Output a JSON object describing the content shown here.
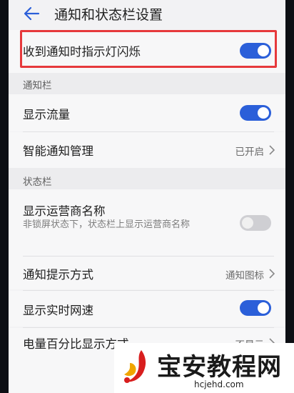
{
  "header": {
    "title": "通知和状态栏设置"
  },
  "top_toggle": {
    "label": "收到通知时指示灯闪烁",
    "on": true
  },
  "notification_bar": {
    "section_label": "通知栏",
    "show_traffic": {
      "label": "显示流量",
      "on": true
    },
    "smart_notify": {
      "label": "智能通知管理",
      "value": "已开启"
    }
  },
  "status_bar": {
    "section_label": "状态栏",
    "carrier_name": {
      "label": "显示运营商名称",
      "sub": "非锁屏状态下，状态栏上显示运营商名称",
      "on": false
    },
    "notify_style": {
      "label": "通知提示方式",
      "value": "通知图标"
    },
    "net_speed": {
      "label": "显示实时网速",
      "on": true
    },
    "battery_percent": {
      "label": "电量百分比显示方式",
      "value": "不显示"
    }
  },
  "watermark": {
    "title": "宝安教程网",
    "url": "hcjehd.com"
  },
  "colors": {
    "accent": "#2b5fd9",
    "highlight": "#e6393c"
  }
}
